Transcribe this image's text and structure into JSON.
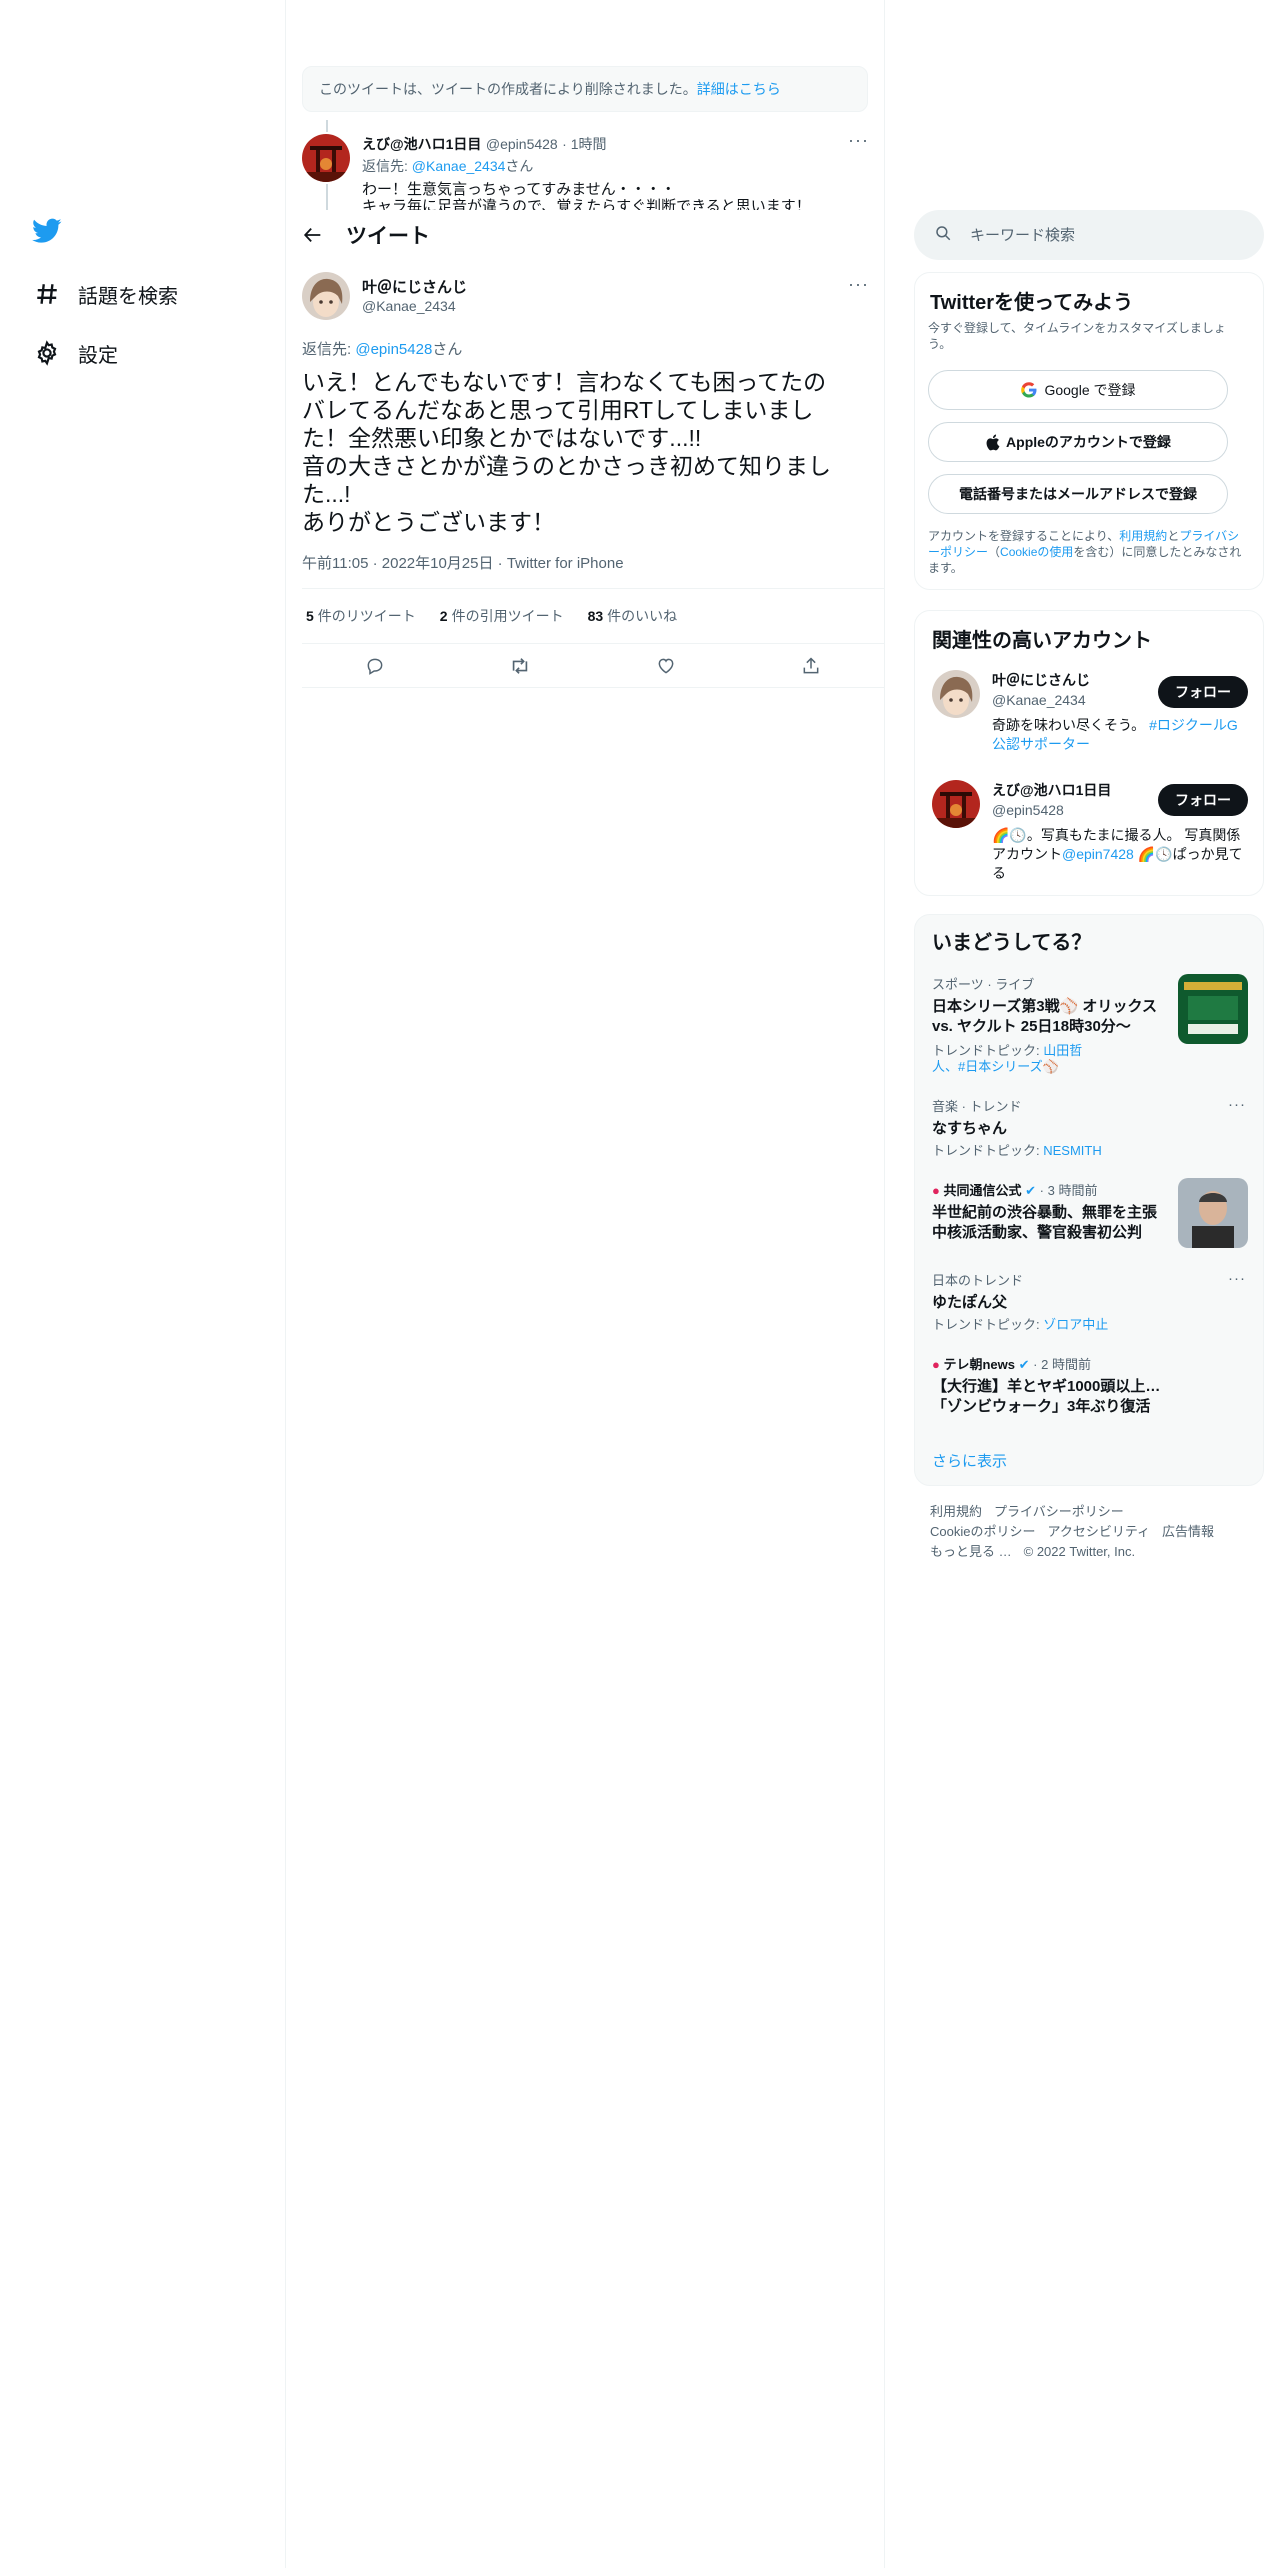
{
  "nav": {
    "items": [
      {
        "label": "話題を検索",
        "icon": "hashtag-icon"
      },
      {
        "label": "設定",
        "icon": "gear-icon"
      }
    ]
  },
  "notice": {
    "text": "このツイートは、ツイートの作成者により削除されました。",
    "link": "詳細はこちら"
  },
  "parent_tweet": {
    "name": "えび@池ハロ1日目",
    "handle": "@epin5428",
    "time": "· 1時間",
    "reply_prefix": "返信先: ",
    "reply_to": "@Kanae_2434",
    "reply_suffix": "さん",
    "line1": "わー！生意気言っちゃってすみません・・・・",
    "line2": "キャラ毎に足音が違うので、覚えたらすぐ判断できると思います！"
  },
  "header": {
    "title": "ツイート"
  },
  "main_tweet": {
    "name": "叶＠にじさんじ",
    "handle": "@Kanae_2434",
    "reply_prefix": "返信先: ",
    "reply_to": "@epin5428",
    "reply_suffix": "さん",
    "text": "いえ！とんでもないです！言わなくても困ってたの\nバレてるんだなあと思って引用RTしてしまいまし\nた！全然悪い印象とかではないです...!!\n音の大きさとかが違うのとかさっき初めて知りまし\nた...!\nありがとうございます！",
    "meta": "午前11:05 · 2022年10月25日 · Twitter for iPhone",
    "retweets": "5",
    "retweets_label": "件のリツイート",
    "quotes": "2",
    "quotes_label": "件の引用ツイート",
    "likes": "83",
    "likes_label": "件のいいね"
  },
  "search": {
    "placeholder": "キーワード検索"
  },
  "signup": {
    "title": "Twitterを使ってみよう",
    "subtitle": "今すぐ登録して、タイムラインをカスタマイズしましょう。",
    "google": "Google で登録",
    "apple": "Appleのアカウントで登録",
    "phone": "電話番号またはメールアドレスで登録",
    "terms_1": "アカウントを登録することにより、",
    "terms_link1": "利用規約",
    "terms_2": "と",
    "terms_link2": "プライバシーポリシー",
    "terms_3": "（",
    "terms_link3": "Cookieの使用",
    "terms_4": "を含む）に同意したとみなされます。"
  },
  "related": {
    "title": "関連性の高いアカウント",
    "accounts": [
      {
        "name": "叶＠にじさんじ",
        "handle": "@Kanae_2434",
        "follow": "フォロー",
        "bio_1": "奇跡を味わい尽くそう。 ",
        "bio_link": "#ロジクールG公認サポーター",
        "bio_2": ""
      },
      {
        "name": "えび@池ハロ1日目",
        "handle": "@epin5428",
        "follow": "フォロー",
        "bio_1": "🌈🕓。写真もたまに撮る人。 写真関係アカウント",
        "bio_link": "@epin7428",
        "bio_2": " 🌈🕓ぱっか見てる"
      }
    ]
  },
  "trends": {
    "title": "いまどうしてる？",
    "items": [
      {
        "category": "スポーツ · ライブ",
        "title": "日本シリーズ第3戦⚾ オリックス vs. ヤクルト 25日18時30分〜",
        "sub_label": "トレンドトピック: ",
        "sub_link": "山田哲人、#日本シリーズ⚾"
      },
      {
        "category": "音楽 · トレンド",
        "title": "なすちゃん",
        "sub_label": "トレンドトピック: ",
        "sub_link": "NESMITH"
      },
      {
        "category": "共同通信公式",
        "time": "· 3 時間前",
        "title": "半世紀前の渋谷暴動、無罪を主張 中核派活動家、警官殺害初公判"
      },
      {
        "category": "日本のトレンド",
        "title": "ゆたぽん父",
        "sub_label": "トレンドトピック: ",
        "sub_link": "ゾロア中止"
      },
      {
        "category": "テレ朝news",
        "time": "· 2 時間前",
        "title": "【大行進】羊とヤギ1000頭以上… 「ゾンビウォーク」3年ぶり復活"
      }
    ],
    "more": "さらに表示"
  },
  "footer": {
    "links": [
      "利用規約",
      "プライバシーポリシー",
      "Cookieのポリシー",
      "アクセシビリティ",
      "広告情報",
      "もっと見る …"
    ],
    "copyright": "© 2022 Twitter, Inc."
  },
  "colors": {
    "accent": "#1d9bf0",
    "text": "#0f1419",
    "muted": "#536471",
    "border": "#eff3f4"
  }
}
